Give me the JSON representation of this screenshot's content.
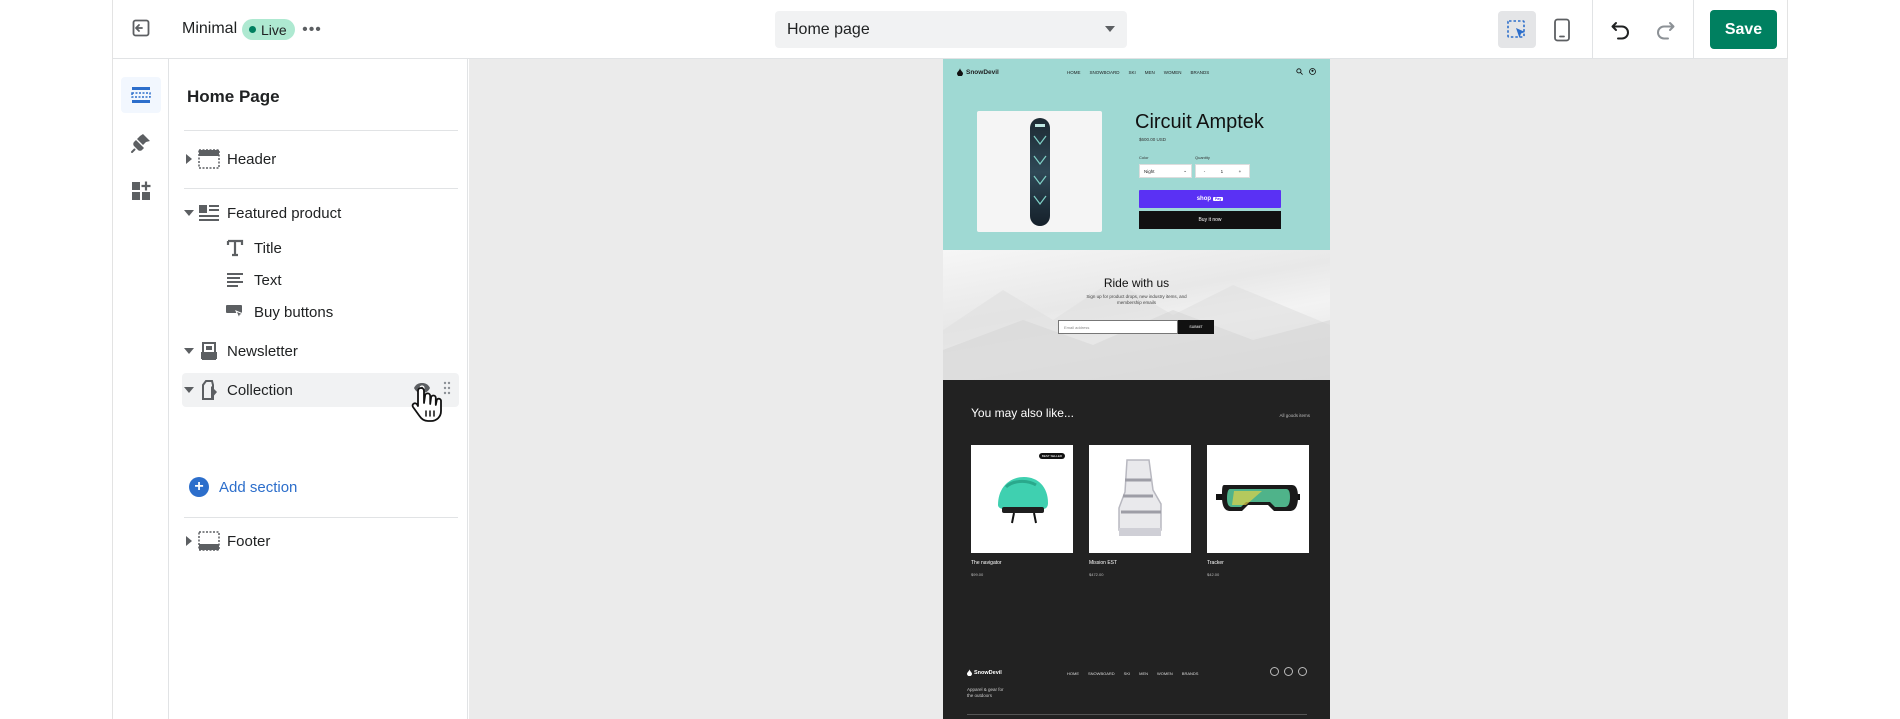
{
  "topbar": {
    "theme_name": "Minimal",
    "status_badge": "Live",
    "more_label": "•••",
    "page_selector": "Home page",
    "save_label": "Save"
  },
  "panel": {
    "title": "Home Page",
    "sections": {
      "header": "Header",
      "featured": "Featured product",
      "featured_blocks": [
        "Title",
        "Text",
        "Buy buttons"
      ],
      "newsletter": "Newsletter",
      "collection": "Collection",
      "add_section": "Add section",
      "footer": "Footer"
    }
  },
  "preview": {
    "store_name": "SnowDevil",
    "nav_links": [
      "HOME",
      "SNOWBOARD",
      "SKI",
      "MEN",
      "WOMEN",
      "BRANDS"
    ],
    "product": {
      "title": "Circuit Amptek",
      "price": "$600.00 USD",
      "color_label": "Color",
      "color_value": "Night",
      "quantity_label": "Quantity",
      "quantity_minus": "-",
      "quantity_value": "1",
      "quantity_plus": "+",
      "shop_pay_label": "shop",
      "shop_pay_badge": "Pay",
      "buy_now_label": "Buy it now"
    },
    "newsletter": {
      "title": "Ride with us",
      "subtitle_line1": "Sign up for product drops, new industry items, and",
      "subtitle_line2": "membership emails",
      "email_placeholder": "Email address",
      "submit_label": "SUBMIT"
    },
    "collection": {
      "title": "You may also like...",
      "view_all": "All goods items",
      "items": [
        {
          "name": "The navigator",
          "price": "$99.00",
          "badge": "BEST SELLER"
        },
        {
          "name": "Mission EST",
          "price": "$472.00"
        },
        {
          "name": "Tracker",
          "price": "$42.00"
        }
      ]
    },
    "footer": {
      "tagline_line1": "Apparel & gear for",
      "tagline_line2": "the outdoors"
    }
  },
  "colors": {
    "save_green": "#008060",
    "hero_teal": "#9fd9d3",
    "shop_pay_purple": "#5a31f4",
    "link_blue": "#2c6ecb"
  }
}
